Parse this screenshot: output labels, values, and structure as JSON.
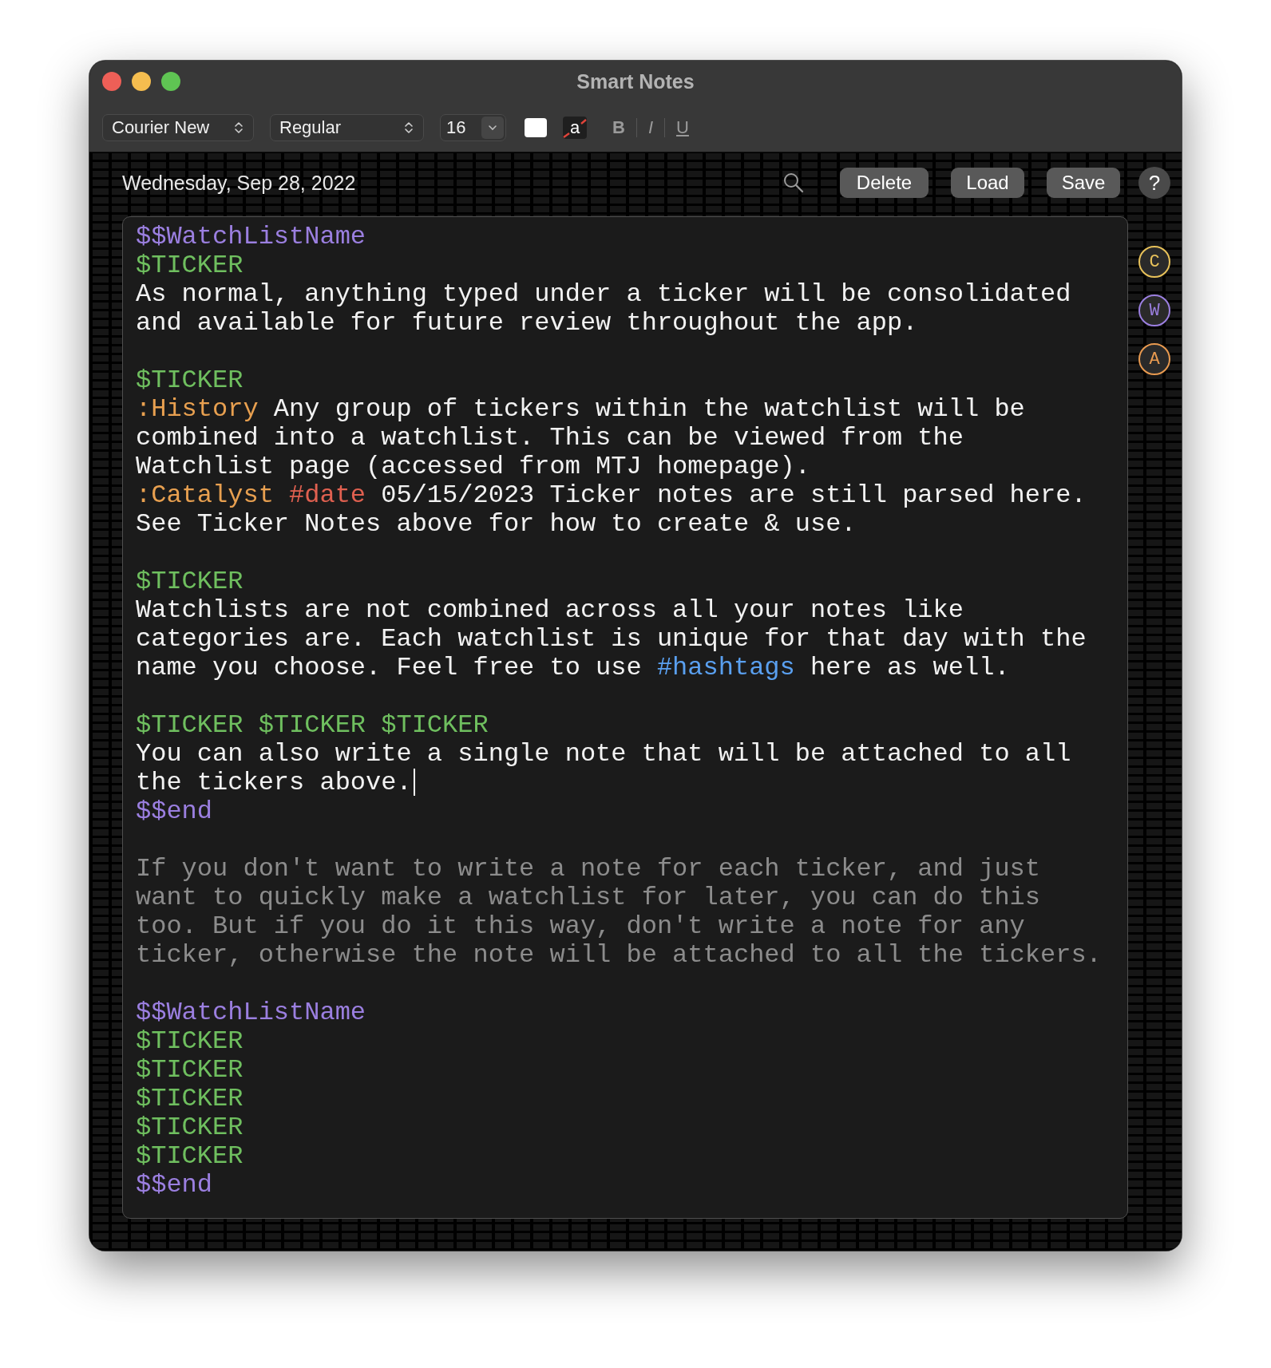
{
  "window": {
    "title": "Smart Notes"
  },
  "toolbar": {
    "font": "Courier New",
    "style": "Regular",
    "size": "16",
    "highlight_label": "a",
    "format_buttons": [
      {
        "label": "B",
        "kind": "bold",
        "on": false
      },
      {
        "label": "I",
        "kind": "italic",
        "on": false
      },
      {
        "label": "U",
        "kind": "underline",
        "on": false
      }
    ]
  },
  "header": {
    "date": "Wednesday, Sep 28, 2022",
    "buttons": [
      "Delete",
      "Load",
      "Save"
    ],
    "help": "?"
  },
  "editor": {
    "blocks": [
      {
        "lines": [
          {
            "cursor": false,
            "segments": [
              {
                "kind": "watchlist",
                "text": "$$WatchListName"
              }
            ]
          },
          {
            "cursor": false,
            "segments": [
              {
                "kind": "ticker",
                "text": "$TICKER"
              }
            ]
          },
          {
            "cursor": false,
            "segments": [
              {
                "kind": "text",
                "text": "As normal, anything typed under a ticker will be consolidated"
              }
            ]
          },
          {
            "cursor": false,
            "segments": [
              {
                "kind": "text",
                "text": "and available for future review throughout the app."
              }
            ]
          }
        ]
      },
      {
        "lines": [
          {
            "cursor": false,
            "segments": [
              {
                "kind": "ticker",
                "text": "$TICKER"
              }
            ]
          },
          {
            "cursor": false,
            "segments": [
              {
                "kind": "tag",
                "text": ":History"
              },
              {
                "kind": "text",
                "text": " Any group of tickers within the watchlist will be"
              }
            ]
          },
          {
            "cursor": false,
            "segments": [
              {
                "kind": "text",
                "text": "combined into a watchlist. This can be viewed from the"
              }
            ]
          },
          {
            "cursor": false,
            "segments": [
              {
                "kind": "text",
                "text": "Watchlist page (accessed from MTJ homepage)."
              }
            ]
          },
          {
            "cursor": false,
            "segments": [
              {
                "kind": "tag",
                "text": ":Catalyst"
              },
              {
                "kind": "date_tag",
                "text": " #date"
              },
              {
                "kind": "text",
                "text": " 05/15/2023 Ticker notes are still parsed here."
              }
            ]
          },
          {
            "cursor": false,
            "segments": [
              {
                "kind": "text",
                "text": "See Ticker Notes above for how to create & use."
              }
            ]
          }
        ]
      },
      {
        "lines": [
          {
            "cursor": false,
            "segments": [
              {
                "kind": "ticker",
                "text": "$TICKER"
              }
            ]
          },
          {
            "cursor": false,
            "segments": [
              {
                "kind": "text",
                "text": "Watchlists are not combined across all your notes like"
              }
            ]
          },
          {
            "cursor": false,
            "segments": [
              {
                "kind": "text",
                "text": "categories are. Each watchlist is unique for that day with the"
              }
            ]
          },
          {
            "cursor": false,
            "segments": [
              {
                "kind": "text",
                "text": "name you choose. Feel free to use "
              },
              {
                "kind": "hashtag",
                "text": "#hashtags"
              },
              {
                "kind": "text",
                "text": " here as well."
              }
            ]
          }
        ]
      },
      {
        "lines": [
          {
            "cursor": false,
            "segments": [
              {
                "kind": "ticker",
                "text": "$TICKER $TICKER $TICKER"
              }
            ]
          },
          {
            "cursor": false,
            "segments": [
              {
                "kind": "text",
                "text": "You can also write a single note that will be attached to all"
              }
            ]
          },
          {
            "cursor": true,
            "segments": [
              {
                "kind": "text",
                "text": "the tickers above."
              }
            ]
          },
          {
            "cursor": false,
            "segments": [
              {
                "kind": "watchlist",
                "text": "$$end"
              }
            ]
          }
        ]
      },
      {
        "lines": [
          {
            "cursor": false,
            "segments": [
              {
                "kind": "comment",
                "text": "If you don't want to write a note for each ticker, and just"
              }
            ]
          },
          {
            "cursor": false,
            "segments": [
              {
                "kind": "comment",
                "text": "want to quickly make a watchlist for later, you can do this"
              }
            ]
          },
          {
            "cursor": false,
            "segments": [
              {
                "kind": "comment",
                "text": "too. But if you do it this way, don't write a note for any"
              }
            ]
          },
          {
            "cursor": false,
            "segments": [
              {
                "kind": "comment",
                "text": "ticker, otherwise the note will be attached to all the tickers."
              }
            ]
          }
        ]
      },
      {
        "lines": [
          {
            "cursor": false,
            "segments": [
              {
                "kind": "watchlist",
                "text": "$$WatchListName"
              }
            ]
          },
          {
            "cursor": false,
            "segments": [
              {
                "kind": "ticker",
                "text": "$TICKER"
              }
            ]
          },
          {
            "cursor": false,
            "segments": [
              {
                "kind": "ticker",
                "text": "$TICKER"
              }
            ]
          },
          {
            "cursor": false,
            "segments": [
              {
                "kind": "ticker",
                "text": "$TICKER"
              }
            ]
          },
          {
            "cursor": false,
            "segments": [
              {
                "kind": "ticker",
                "text": "$TICKER"
              }
            ]
          },
          {
            "cursor": false,
            "segments": [
              {
                "kind": "ticker",
                "text": "$TICKER"
              }
            ]
          },
          {
            "cursor": false,
            "segments": [
              {
                "kind": "watchlist",
                "text": "$$end"
              }
            ]
          }
        ]
      }
    ]
  },
  "side_badges": [
    {
      "label": "C",
      "color": "#e8c25a"
    },
    {
      "label": "W",
      "color": "#9b7fe0"
    },
    {
      "label": "A",
      "color": "#e89a50"
    }
  ]
}
